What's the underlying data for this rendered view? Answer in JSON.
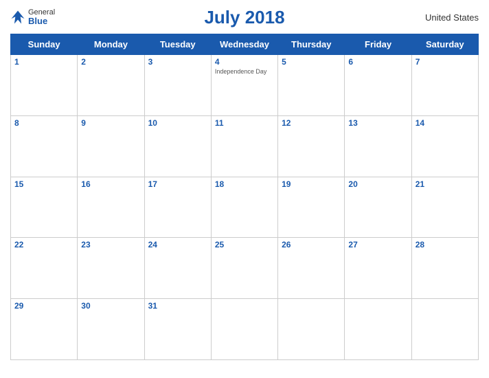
{
  "header": {
    "title": "July 2018",
    "country": "United States",
    "logo": {
      "general": "General",
      "blue": "Blue"
    }
  },
  "weekdays": [
    "Sunday",
    "Monday",
    "Tuesday",
    "Wednesday",
    "Thursday",
    "Friday",
    "Saturday"
  ],
  "weeks": [
    [
      {
        "day": "1",
        "event": ""
      },
      {
        "day": "2",
        "event": ""
      },
      {
        "day": "3",
        "event": ""
      },
      {
        "day": "4",
        "event": "Independence Day"
      },
      {
        "day": "5",
        "event": ""
      },
      {
        "day": "6",
        "event": ""
      },
      {
        "day": "7",
        "event": ""
      }
    ],
    [
      {
        "day": "8",
        "event": ""
      },
      {
        "day": "9",
        "event": ""
      },
      {
        "day": "10",
        "event": ""
      },
      {
        "day": "11",
        "event": ""
      },
      {
        "day": "12",
        "event": ""
      },
      {
        "day": "13",
        "event": ""
      },
      {
        "day": "14",
        "event": ""
      }
    ],
    [
      {
        "day": "15",
        "event": ""
      },
      {
        "day": "16",
        "event": ""
      },
      {
        "day": "17",
        "event": ""
      },
      {
        "day": "18",
        "event": ""
      },
      {
        "day": "19",
        "event": ""
      },
      {
        "day": "20",
        "event": ""
      },
      {
        "day": "21",
        "event": ""
      }
    ],
    [
      {
        "day": "22",
        "event": ""
      },
      {
        "day": "23",
        "event": ""
      },
      {
        "day": "24",
        "event": ""
      },
      {
        "day": "25",
        "event": ""
      },
      {
        "day": "26",
        "event": ""
      },
      {
        "day": "27",
        "event": ""
      },
      {
        "day": "28",
        "event": ""
      }
    ],
    [
      {
        "day": "29",
        "event": ""
      },
      {
        "day": "30",
        "event": ""
      },
      {
        "day": "31",
        "event": ""
      },
      {
        "day": "",
        "event": ""
      },
      {
        "day": "",
        "event": ""
      },
      {
        "day": "",
        "event": ""
      },
      {
        "day": "",
        "event": ""
      }
    ]
  ]
}
